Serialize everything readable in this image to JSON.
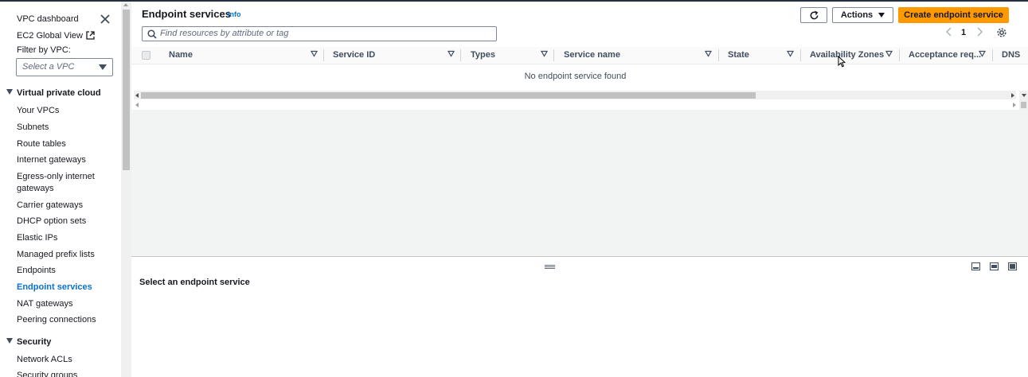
{
  "sidebar": {
    "top_links": [
      {
        "label": "VPC dashboard"
      },
      {
        "label": "EC2 Global View"
      }
    ],
    "filter_label": "Filter by VPC:",
    "filter_placeholder": "Select a VPC",
    "sections": [
      {
        "title": "Virtual private cloud",
        "items": [
          {
            "label": "Your VPCs"
          },
          {
            "label": "Subnets"
          },
          {
            "label": "Route tables"
          },
          {
            "label": "Internet gateways"
          },
          {
            "label": "Egress-only internet gateways"
          },
          {
            "label": "Carrier gateways"
          },
          {
            "label": "DHCP option sets"
          },
          {
            "label": "Elastic IPs"
          },
          {
            "label": "Managed prefix lists"
          },
          {
            "label": "Endpoints"
          },
          {
            "label": "Endpoint services",
            "active": true
          },
          {
            "label": "NAT gateways"
          },
          {
            "label": "Peering connections"
          }
        ]
      },
      {
        "title": "Security",
        "items": [
          {
            "label": "Network ACLs"
          },
          {
            "label": "Security groups"
          }
        ]
      }
    ],
    "egress_line1": "Egress-only internet",
    "egress_line2": "gateways"
  },
  "header": {
    "title": "Endpoint services",
    "info": "Info",
    "actions_label": "Actions",
    "create_label": "Create endpoint service"
  },
  "search": {
    "placeholder": "Find resources by attribute or tag"
  },
  "pagination": {
    "current_page": "1"
  },
  "table": {
    "columns": [
      "Name",
      "Service ID",
      "Types",
      "Service name",
      "State",
      "Availability Zones",
      "Acceptance req...",
      "DNS"
    ],
    "empty_message": "No endpoint service found"
  },
  "split_panel": {
    "title": "Select an endpoint service"
  },
  "colors": {
    "accent": "#0972d3",
    "primary_button": "#ff9900"
  }
}
